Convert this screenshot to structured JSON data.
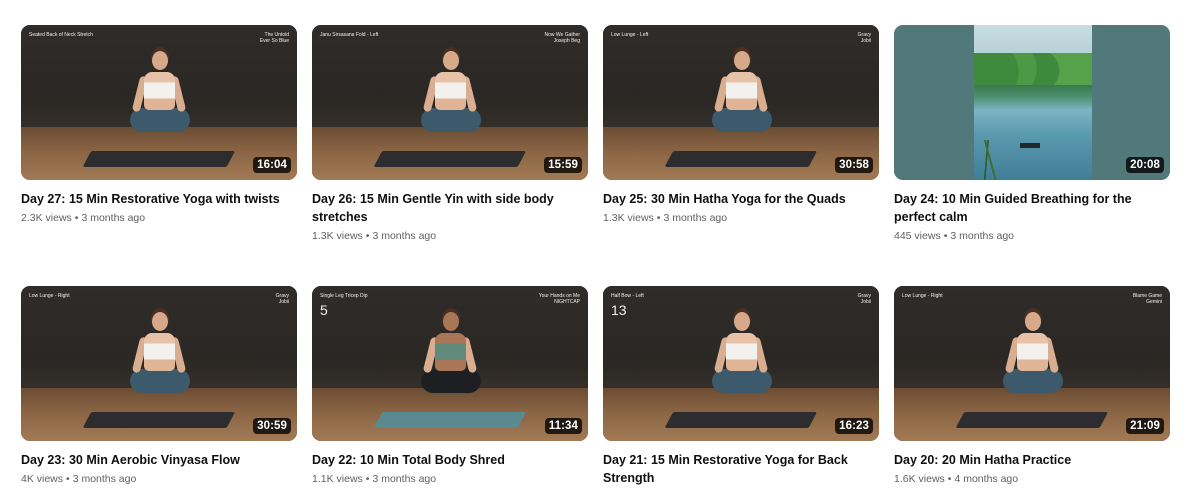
{
  "videos": [
    {
      "title": "Day 27: 15 Min Restorative Yoga with twists",
      "views": "2.3K views",
      "age": "3 months ago",
      "duration": "16:04",
      "overlay_left": "Seated Back of Neck Stretch",
      "overlay_right": "The Untold\nEver So Blue",
      "counter": "",
      "thumbnail_kind": "yoga"
    },
    {
      "title": "Day 26: 15 Min Gentle Yin with side body stretches",
      "views": "1.3K views",
      "age": "3 months ago",
      "duration": "15:59",
      "overlay_left": "Janu Sirsasana Fold - Left",
      "overlay_right": "Now We Gather\nJoseph Beg",
      "counter": "",
      "thumbnail_kind": "yoga"
    },
    {
      "title": "Day 25: 30 Min Hatha Yoga for the Quads",
      "views": "1.3K views",
      "age": "3 months ago",
      "duration": "30:58",
      "overlay_left": "Low Lunge - Left",
      "overlay_right": "Gravy\nJobii",
      "counter": "",
      "thumbnail_kind": "yoga"
    },
    {
      "title": "Day 24: 10 Min Guided Breathing for the perfect calm",
      "views": "445 views",
      "age": "3 months ago",
      "duration": "20:08",
      "overlay_left": "",
      "overlay_right": "",
      "counter": "",
      "thumbnail_kind": "nature"
    },
    {
      "title": "Day 23: 30 Min Aerobic Vinyasa Flow",
      "views": "4K views",
      "age": "3 months ago",
      "duration": "30:59",
      "overlay_left": "Low Lunge - Right",
      "overlay_right": "Gravy\nJobii",
      "counter": "",
      "thumbnail_kind": "yoga"
    },
    {
      "title": "Day 22: 10 Min Total Body Shred",
      "views": "1.1K views",
      "age": "3 months ago",
      "duration": "11:34",
      "overlay_left": "Single Leg Tricep Dip",
      "overlay_right": "Your Hands on Me\nNIGHTCAP",
      "counter": "5",
      "thumbnail_kind": "yoga"
    },
    {
      "title": "Day 21: 15 Min Restorative Yoga for Back Strength",
      "views": "",
      "age": "",
      "duration": "16:23",
      "overlay_left": "Half Bow - Left",
      "overlay_right": "Gravy\nJobii",
      "counter": "13",
      "thumbnail_kind": "yoga"
    },
    {
      "title": "Day 20: 20 Min Hatha Practice",
      "views": "1.6K views",
      "age": "4 months ago",
      "duration": "21:09",
      "overlay_left": "Low Lunge - Right",
      "overlay_right": "Blame Game\nGemini",
      "counter": "",
      "thumbnail_kind": "yoga"
    }
  ],
  "separator": "•"
}
